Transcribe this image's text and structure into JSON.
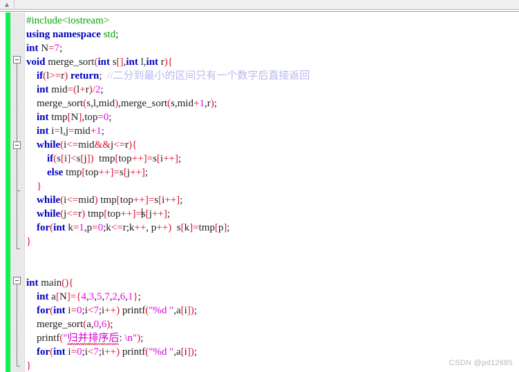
{
  "window": {
    "topbar_caret_icon": "chevron-up-icon"
  },
  "editor": {
    "language": "cpp",
    "font_size_px": 15,
    "line_height_px": 20,
    "colors": {
      "background": "#ffffff",
      "keyword": "#0000c0",
      "preprocessor": "#00a800",
      "namespace": "#00a000",
      "identifier": "#202020",
      "number": "#f000f0",
      "operator": "#e01030",
      "string": "#d000d0",
      "comment": "#b8b8ee",
      "change_bar": "#11f055",
      "gutter_background": "#fbfbfb",
      "spellcheck_underline": "#e01030"
    },
    "change_bar_present": true,
    "fold_markers": [
      {
        "line": 4,
        "state": "expanded"
      },
      {
        "line": 9,
        "state": "expanded"
      },
      {
        "line": 20,
        "state": "expanded"
      }
    ],
    "caret": {
      "line": 15,
      "column_token": "s"
    }
  },
  "code": {
    "lines": [
      {
        "n": 1,
        "indent": 0,
        "text": "#include<iostream>"
      },
      {
        "n": 2,
        "indent": 0,
        "text": "using namespace std;"
      },
      {
        "n": 3,
        "indent": 0,
        "text": "int N=7;"
      },
      {
        "n": 4,
        "indent": 0,
        "text": "void merge_sort(int s[],int l,int r){"
      },
      {
        "n": 5,
        "indent": 1,
        "text": "if(l>=r) return; //二分到最小的区间只有一个数字后直接返回"
      },
      {
        "n": 6,
        "indent": 1,
        "text": "int mid=(l+r)/2;"
      },
      {
        "n": 7,
        "indent": 1,
        "text": "merge_sort(s,l,mid),merge_sort(s,mid+1,r);"
      },
      {
        "n": 8,
        "indent": 1,
        "text": "int tmp[N],top=0;"
      },
      {
        "n": 9,
        "indent": 1,
        "text": "int i=l,j=mid+1;"
      },
      {
        "n": 10,
        "indent": 1,
        "text": "while(i<=mid&&j<=r){"
      },
      {
        "n": 11,
        "indent": 2,
        "text": "if(s[i]<s[j]) tmp[top++]=s[i++];"
      },
      {
        "n": 12,
        "indent": 2,
        "text": "else tmp[top++]=s[j++];"
      },
      {
        "n": 13,
        "indent": 1,
        "text": "}"
      },
      {
        "n": 14,
        "indent": 1,
        "text": "while(i<=mid) tmp[top++]=s[i++];"
      },
      {
        "n": 15,
        "indent": 1,
        "text": "while(j<=r) tmp[top++]=s[j++];"
      },
      {
        "n": 16,
        "indent": 1,
        "text": "for(int k=l,p=0;k<=r;k++,p++) s[k]=tmp[p];"
      },
      {
        "n": 17,
        "indent": 0,
        "text": "}"
      },
      {
        "n": 18,
        "indent": 0,
        "text": ""
      },
      {
        "n": 19,
        "indent": 0,
        "text": ""
      },
      {
        "n": 20,
        "indent": 0,
        "text": "int main(){"
      },
      {
        "n": 21,
        "indent": 1,
        "text": "int a[N]={4,3,5,7,2,6,1};"
      },
      {
        "n": 22,
        "indent": 1,
        "text": "for(int i=0;i<7;i++) printf(\"%d \",a[i]);"
      },
      {
        "n": 23,
        "indent": 1,
        "text": "merge_sort(a,0,6);"
      },
      {
        "n": 24,
        "indent": 1,
        "text": "printf(\"归并排序后: \\n\");"
      },
      {
        "n": 25,
        "indent": 1,
        "text": "for(int i=0;i<7;i++) printf(\"%d \",a[i]);"
      },
      {
        "n": 26,
        "indent": 0,
        "text": "}"
      }
    ],
    "comment_line5": "//二分到最小的区间只有一个数字后直接返回",
    "string_line24": "归并排序后: \\n",
    "array_literal": [
      4,
      3,
      5,
      7,
      2,
      6,
      1
    ],
    "constant_N": 7
  },
  "watermark": {
    "text": "CSDN @pd12685"
  }
}
